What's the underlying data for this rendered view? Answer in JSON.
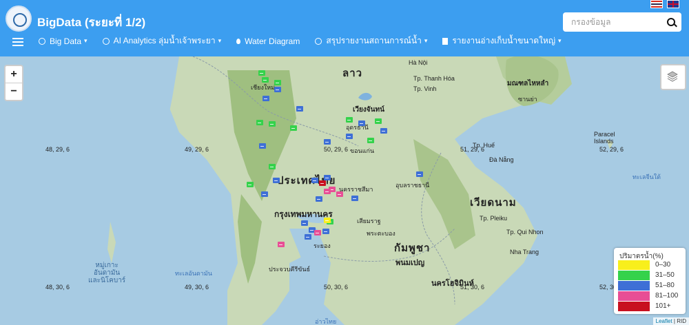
{
  "header": {
    "title": "BigData (ระยะที่ 1/2)",
    "search_placeholder": "กรองข้อมูล"
  },
  "nav": {
    "items": [
      {
        "label": "Big Data",
        "has_dropdown": true,
        "icon": "globe-icon"
      },
      {
        "label": "AI Analytics ลุ่มน้ำเจ้าพระยา",
        "has_dropdown": true,
        "icon": "globe-icon"
      },
      {
        "label": "Water Diagram",
        "has_dropdown": false,
        "icon": "droplet-icon"
      },
      {
        "label": "สรุปรายงานสถานการณ์น้ำ",
        "has_dropdown": true,
        "icon": "globe-icon"
      },
      {
        "label": "รายงานอ่างเก็บน้ำขนาดใหญ่",
        "has_dropdown": true,
        "icon": "file-icon"
      }
    ],
    "dropdown_caret": "▾"
  },
  "map": {
    "zoom_in": "+",
    "zoom_out": "−",
    "labels": {
      "laos": "ลาว",
      "thailand": "ประเทศไทย",
      "vietnam": "เวียดนาม",
      "cambodia": "กัมพูชา",
      "bangkok": "กรุงเทพมหานคร",
      "vientiane": "เวียงจันทน์",
      "phnompenh": "พนมเปญ",
      "hcmc": "นครโฮจิมินห์",
      "hainan": "มณฑลไหหลำ",
      "sanya": "ซานย่า",
      "andaman": "หมู่เกาะ\nอันดามัน\nและนิโคบาร์",
      "ho_noi": "Hà Nội",
      "tp_vinh": "Tp. Vinh",
      "tp_thanh_hoa": "Tp. Thanh Hóa",
      "tp_hue": "Tp. Huế",
      "da_nang": "Đà Nẵng",
      "tp_pleiku": "Tp. Pleiku",
      "tp_qui_nhon": "Tp. Qui Nhon",
      "nha_trang": "Nha Trang",
      "paracel": "Paracel\nIslands",
      "south_china_sea": "ทะเลจีนใต้",
      "andaman_sea": "ทะเลอันดามัน",
      "gulf": "อ่าวไทย",
      "chiang_mai": "เชียงใหม่",
      "udon": "อุดรธานี",
      "khon_kaen": "ขอนแก่น",
      "nakhon_ratchasima": "นครราชสีมา",
      "ubon": "อุบลราชธานี",
      "siem_reap": "เสียมราฐ",
      "battambang": "พระตะบอง",
      "rayong": "ระยอง",
      "hua_hin": "ประจวบคีรีขันธ์"
    },
    "grid_labels": [
      {
        "text": "48, 29, 6"
      },
      {
        "text": "49, 29, 6"
      },
      {
        "text": "50, 29, 6"
      },
      {
        "text": "51, 29, 6"
      },
      {
        "text": "52, 29, 6"
      },
      {
        "text": "48, 30, 6"
      },
      {
        "text": "49, 30, 6"
      },
      {
        "text": "50, 30, 6"
      },
      {
        "text": "51, 30, 6"
      },
      {
        "text": "52, 30, 6"
      }
    ],
    "markers_summary": {
      "level_0_30": 2,
      "level_31_50": 14,
      "level_51_80": 20,
      "level_81_100": 5,
      "level_101_plus": 1
    }
  },
  "legend": {
    "title": "ปริมาตรน้ำ(%)",
    "items": [
      {
        "label": "0–30",
        "color": "#f8ef1c"
      },
      {
        "label": "31–50",
        "color": "#35d24b"
      },
      {
        "label": "51–80",
        "color": "#3e6fd6"
      },
      {
        "label": "81–100",
        "color": "#e84e95"
      },
      {
        "label": "101+",
        "color": "#c8101f"
      }
    ]
  },
  "attribution": {
    "leaflet": "Leaflet",
    "separator": " | ",
    "source": "RID"
  },
  "colors": {
    "header_bg": "#3c9ef0",
    "land": "#c9d9b7",
    "land_dark": "#9bbd7e",
    "water": "#a7cbe3"
  }
}
